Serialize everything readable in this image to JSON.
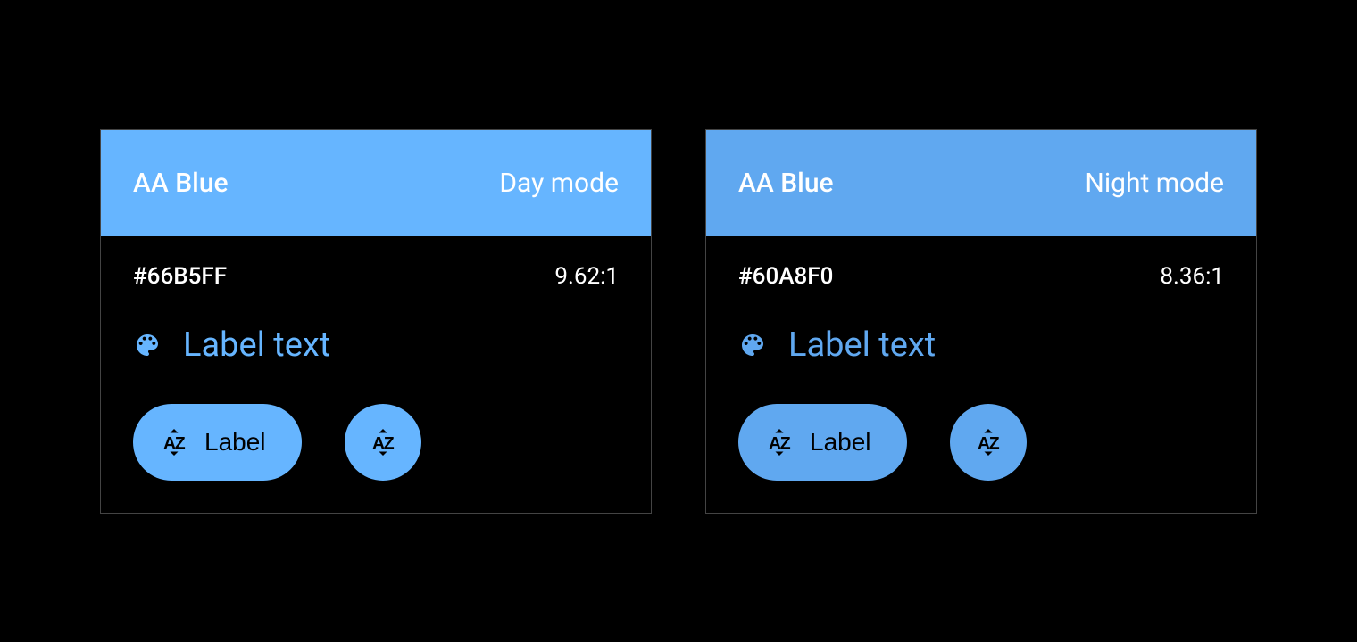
{
  "cards": [
    {
      "title": "AA Blue",
      "mode": "Day mode",
      "hex": "#66B5FF",
      "ratio": "9.62:1",
      "color": "#66B5FF",
      "label_text": "Label text",
      "button_label": "Label"
    },
    {
      "title": "AA Blue",
      "mode": "Night mode",
      "hex": "#60A8F0",
      "ratio": "8.36:1",
      "color": "#60A8F0",
      "label_text": "Label text",
      "button_label": "Label"
    }
  ]
}
